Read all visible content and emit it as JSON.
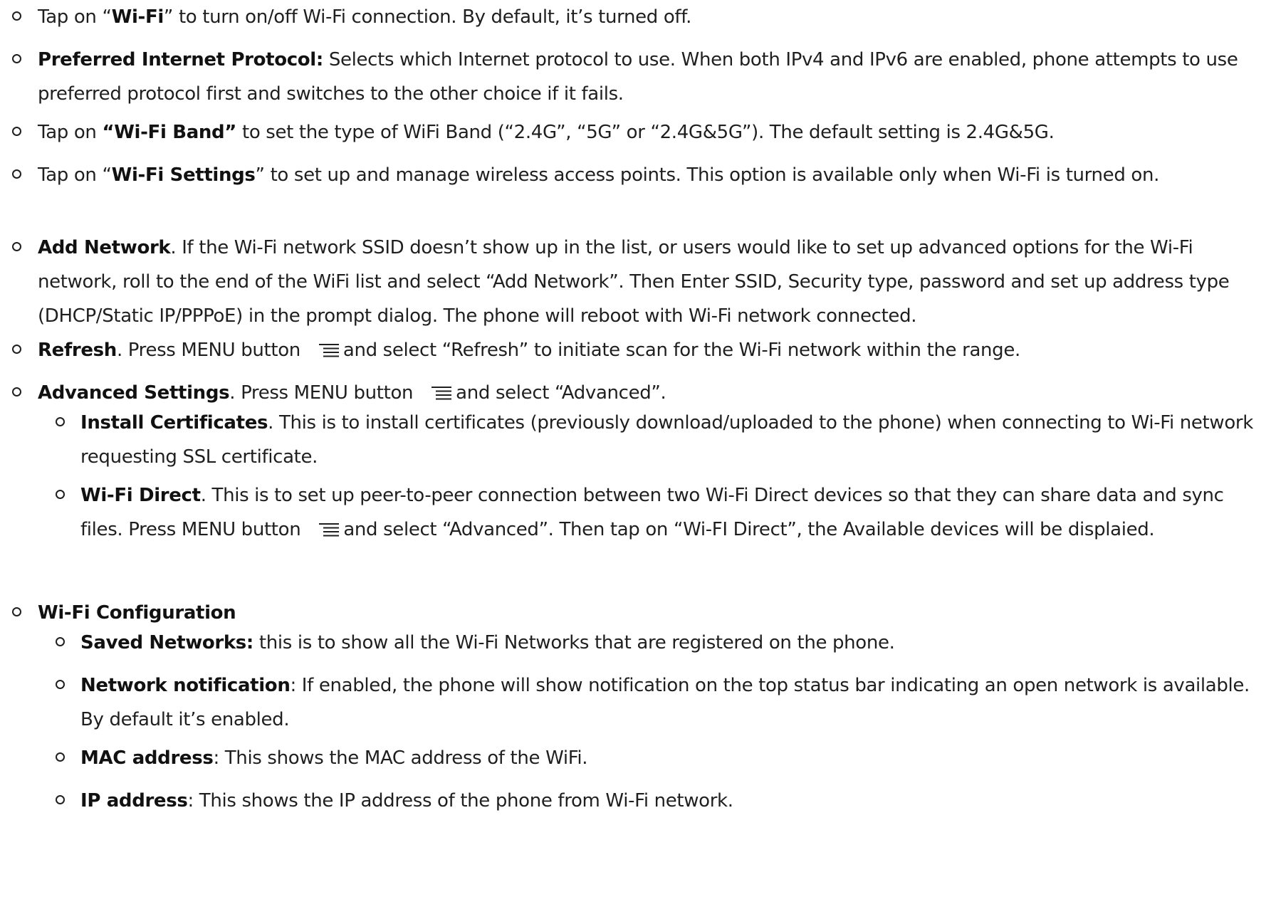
{
  "items": [
    {
      "pre": "Tap on “",
      "bold": "Wi-Fi",
      "post": "” to turn on/off Wi-Fi connection. By default, it’s turned off."
    },
    {
      "bold": "Preferred Internet Protocol:",
      "post": " Selects which Internet protocol to use. When both IPv4 and IPv6 are enabled, phone attempts to use preferred protocol first and switches to the other choice if it fails."
    },
    {
      "pre": "Tap on ",
      "bold": "“Wi-Fi Band”",
      "post": " to set the type of WiFi Band (“2.4G”, “5G” or “2.4G&5G”). The default setting is 2.4G&5G."
    },
    {
      "pre": "Tap on “",
      "bold": "Wi-Fi Settings",
      "post": "” to set up and manage wireless access points. This option is available only when Wi-Fi is turned on."
    },
    {
      "bold": "Add Network",
      "post": ". If the Wi-Fi network SSID doesn’t show up in the list, or users would like to set up advanced options for the Wi-Fi network, roll to the end of the WiFi list and select “Add Network”. Then Enter SSID, Security type, password and set up address type (DHCP/Static IP/PPPoE) in the prompt dialog. The phone will reboot with Wi-Fi network connected."
    },
    {
      "bold": "Refresh",
      "pre_icon": ". Press MENU button",
      "post_icon": "and select “Refresh” to initiate scan for the Wi-Fi network within the range."
    },
    {
      "bold": "Advanced Settings",
      "pre_icon": ". Press MENU button",
      "post_icon": "and select “Advanced”."
    }
  ],
  "advanced_sub": [
    {
      "bold": "Install Certificates",
      "post": ". This is to install certificates (previously download/uploaded to the phone) when connecting to Wi-Fi network requesting SSL certificate."
    },
    {
      "bold": "Wi-Fi Direct",
      "pre_icon": ". This is to set up peer-to-peer connection between two Wi-Fi Direct devices so that they can share data and sync files. Press MENU button",
      "post_icon": "and select “Advanced”. Then tap on “Wi-FI Direct”, the Available devices will be displaied."
    }
  ],
  "config": {
    "title": "Wi-Fi Configuration",
    "sub": [
      {
        "bold": "Saved Networks:",
        "post": " this is to show all the Wi-Fi Networks that are registered on the phone."
      },
      {
        "bold": "Network notification",
        "post": ": If enabled, the phone will show notification on the top status bar indicating an open network is available. By default it’s enabled."
      },
      {
        "bold": "MAC address",
        "post": ": This shows the MAC address of the WiFi."
      },
      {
        "bold": "IP address",
        "post": ": This shows the IP address of the phone from Wi-Fi network."
      }
    ]
  },
  "icons": {
    "menu": "menu-icon"
  }
}
